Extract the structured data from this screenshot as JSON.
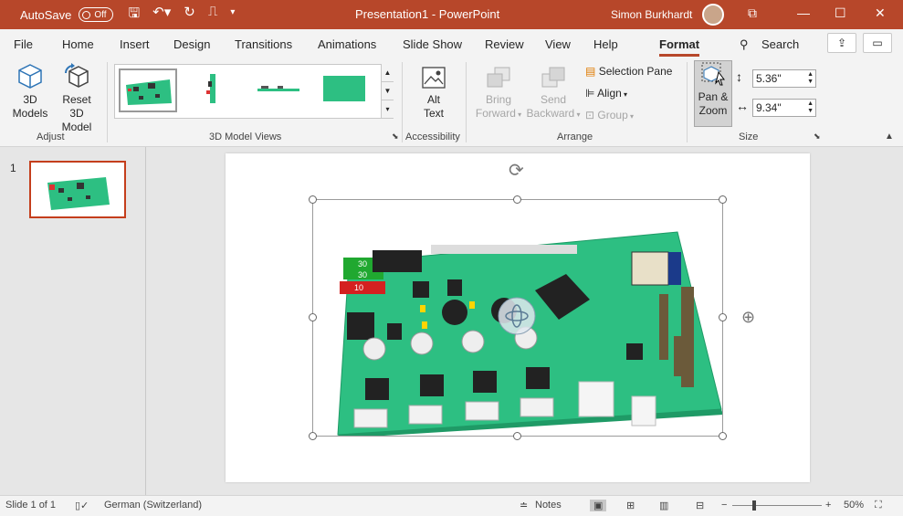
{
  "titlebar": {
    "autosave_label": "AutoSave",
    "autosave_state": "Off",
    "title": "Presentation1  -  PowerPoint",
    "user": "Simon Burkhardt"
  },
  "tabs": [
    "File",
    "Home",
    "Insert",
    "Design",
    "Transitions",
    "Animations",
    "Slide Show",
    "Review",
    "View",
    "Help",
    "Format"
  ],
  "search_label": "Search",
  "ribbon": {
    "adjust": {
      "label": "Adjust",
      "models_label": "3D Models",
      "models_sub": "Models",
      "models_top": "3D",
      "reset_top": "Reset 3D",
      "reset_sub": "Model"
    },
    "views_label": "3D Model Views",
    "accessibility": {
      "label": "Accessibility",
      "alt_top": "Alt",
      "alt_sub": "Text"
    },
    "arrange": {
      "label": "Arrange",
      "bring_top": "Bring",
      "bring_sub": "Forward",
      "send_top": "Send",
      "send_sub": "Backward",
      "selection_pane": "Selection Pane",
      "align": "Align",
      "group": "Group"
    },
    "size": {
      "label": "Size",
      "pan_top": "Pan &",
      "pan_sub": "Zoom",
      "height": "5.36\"",
      "width": "9.34\""
    }
  },
  "slides": {
    "number": "1"
  },
  "status": {
    "slide": "Slide 1 of 1",
    "language": "German (Switzerland)",
    "notes": "Notes",
    "zoom": "50%"
  },
  "colors": {
    "accent": "#b7472a",
    "pcb": "#2dbf82",
    "selected_border": "#c43e1c"
  }
}
